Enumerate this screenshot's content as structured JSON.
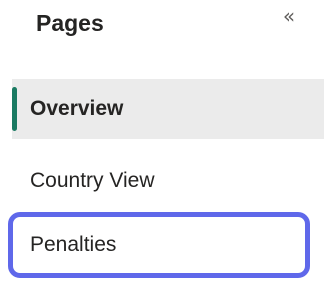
{
  "panel": {
    "title": "Pages",
    "collapse_icon": "«"
  },
  "pages": [
    {
      "label": "Overview",
      "active": true
    },
    {
      "label": "Country View",
      "active": false
    },
    {
      "label": "Penalties",
      "active": false,
      "focused": true
    }
  ],
  "colors": {
    "active_indicator": "#1a7a62",
    "active_background": "#ebebeb",
    "focus_ring": "#5f68ea"
  }
}
